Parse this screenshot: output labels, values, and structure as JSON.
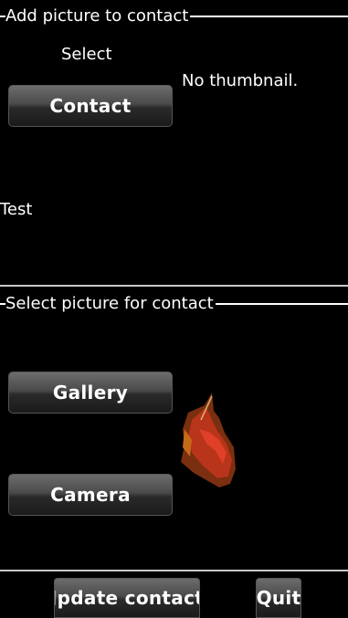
{
  "section_add": {
    "legend": "Add picture to contact",
    "select_label": "Select",
    "contact_button": "Contact",
    "thumbnail_status": "No thumbnail.",
    "contact_name": "Test"
  },
  "section_select": {
    "legend": "Select picture for contact",
    "gallery_button": "Gallery",
    "camera_button": "Camera"
  },
  "bottom_bar": {
    "update_button": "Jpdate contact",
    "quit_button": "Quit"
  },
  "colors": {
    "background": "#000000",
    "divider": "#c8c8c8",
    "button_top": "#6d6d6d",
    "button_bottom": "#1a1a1a"
  }
}
